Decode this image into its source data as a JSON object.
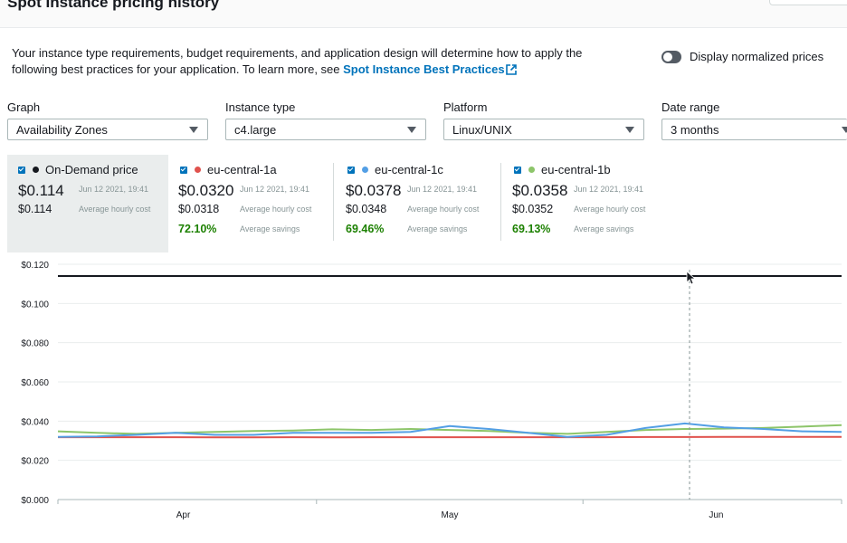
{
  "header": {
    "title": "Spot Instance pricing history"
  },
  "description": {
    "text": "Your instance type requirements, budget requirements, and application design will determine how to apply the following best practices for your application. To learn more, see ",
    "link_label": "Spot Instance Best Practices"
  },
  "toggle": {
    "label": "Display normalized prices",
    "on": false
  },
  "filters": {
    "graph": {
      "label": "Graph",
      "value": "Availability Zones"
    },
    "instance_type": {
      "label": "Instance type",
      "value": "c4.large"
    },
    "platform": {
      "label": "Platform",
      "value": "Linux/UNIX"
    },
    "date_range": {
      "label": "Date range",
      "value": "3 months"
    }
  },
  "legend": [
    {
      "name": "On-Demand price",
      "color": "#16191f",
      "price": "$0.114",
      "timestamp": "Jun 12 2021, 19:41",
      "avg_cost": "$0.114",
      "avg_cost_label": "Average hourly cost"
    },
    {
      "name": "eu-central-1a",
      "color": "#e0524d",
      "price": "$0.0320",
      "timestamp": "Jun 12 2021, 19:41",
      "avg_cost": "$0.0318",
      "avg_cost_label": "Average hourly cost",
      "savings": "72.10%",
      "savings_label": "Average savings"
    },
    {
      "name": "eu-central-1c",
      "color": "#539fe5",
      "price": "$0.0378",
      "timestamp": "Jun 12 2021, 19:41",
      "avg_cost": "$0.0348",
      "avg_cost_label": "Average hourly cost",
      "savings": "69.46%",
      "savings_label": "Average savings"
    },
    {
      "name": "eu-central-1b",
      "color": "#8dc56a",
      "price": "$0.0358",
      "timestamp": "Jun 12 2021, 19:41",
      "avg_cost": "$0.0352",
      "avg_cost_label": "Average hourly cost",
      "savings": "69.13%",
      "savings_label": "Average savings"
    }
  ],
  "chart_data": {
    "type": "line",
    "ylim": [
      0,
      0.12
    ],
    "y_ticks": [
      "$0.000",
      "$0.020",
      "$0.040",
      "$0.060",
      "$0.080",
      "$0.100",
      "$0.120"
    ],
    "x_tick_labels": [
      "Apr",
      "May",
      "Jun"
    ],
    "x": [
      0,
      0.05,
      0.1,
      0.15,
      0.2,
      0.25,
      0.3,
      0.35,
      0.4,
      0.45,
      0.5,
      0.55,
      0.6,
      0.65,
      0.7,
      0.75,
      0.8,
      0.85,
      0.9,
      0.95,
      1
    ],
    "series": [
      {
        "name": "On-Demand price",
        "color": "#16191f",
        "values": [
          0.114,
          0.114,
          0.114,
          0.114,
          0.114,
          0.114,
          0.114,
          0.114,
          0.114,
          0.114,
          0.114,
          0.114,
          0.114,
          0.114,
          0.114,
          0.114,
          0.114,
          0.114,
          0.114,
          0.114,
          0.114
        ]
      },
      {
        "name": "eu-central-1a",
        "color": "#e0524d",
        "values": [
          0.0318,
          0.0318,
          0.0318,
          0.0318,
          0.0317,
          0.0317,
          0.0318,
          0.0317,
          0.0318,
          0.0318,
          0.0318,
          0.0318,
          0.0318,
          0.0318,
          0.0318,
          0.0319,
          0.0319,
          0.032,
          0.032,
          0.032,
          0.032
        ]
      },
      {
        "name": "eu-central-1c",
        "color": "#539fe5",
        "values": [
          0.032,
          0.0322,
          0.033,
          0.034,
          0.033,
          0.033,
          0.034,
          0.034,
          0.034,
          0.0345,
          0.0375,
          0.036,
          0.034,
          0.032,
          0.033,
          0.0365,
          0.0388,
          0.0368,
          0.036,
          0.0348,
          0.0345
        ]
      },
      {
        "name": "eu-central-1b",
        "color": "#8dc56a",
        "values": [
          0.0348,
          0.034,
          0.0335,
          0.034,
          0.0345,
          0.035,
          0.0352,
          0.0358,
          0.0355,
          0.036,
          0.0355,
          0.035,
          0.034,
          0.0335,
          0.0345,
          0.0355,
          0.036,
          0.0362,
          0.0365,
          0.0372,
          0.038
        ]
      }
    ]
  }
}
